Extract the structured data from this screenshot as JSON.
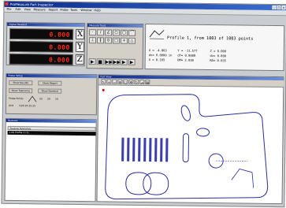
{
  "window": {
    "title": "ProMeasure Part Inspector",
    "minimize": "_",
    "maximize": "□",
    "close": "×"
  },
  "menu": [
    "File",
    "Edit",
    "View",
    "Measure",
    "Report",
    "Probe",
    "Tools",
    "Window",
    "Help"
  ],
  "dro": {
    "title": "Digital Readout",
    "x": {
      "axis": "X",
      "value": "0.000"
    },
    "y": {
      "axis": "Y",
      "value": "0.000"
    },
    "z": {
      "axis": "Z",
      "value": "0.000"
    }
  },
  "tools": {
    "title": "Measure Tools",
    "buttons": [
      "·",
      "/",
      "∠",
      "○",
      "◯",
      "⌒",
      "⊥",
      "∥",
      "⊙",
      "□",
      "+",
      "△"
    ],
    "play_buttons": [
      "▶",
      "■",
      "▶▶",
      "▶▶",
      "▶",
      "▶"
    ]
  },
  "info": {
    "header": "Profile 1, from 1003 of 1003 points",
    "lines": [
      "X = -4.803      Y = -11.577       Z = 0.000",
      "dx= 0.0000 in   dY= 0.0000        dz= 0.000",
      "X = 0.105       DM= 2.038         RD= 0.035"
    ]
  },
  "probe": {
    "title": "Probe Setup",
    "buttons": [
      "Show Results",
      "Show Report",
      "Show Tolerance",
      "Show Nominal"
    ],
    "probe_label": "Probe Points",
    "values": [
      "25",
      "20",
      "10"
    ],
    "unit_label": "Unit",
    "units": "1/20   25   25   25"
  },
  "list": {
    "title": "Features",
    "column": "Feature   Tolerance",
    "selected": "1.00 Profile 1   (1)"
  },
  "drawing": {
    "title": "Part View"
  },
  "colors": {
    "part_outline": "#2b2f9e",
    "dro_digits": "#ff2a1a",
    "titlebar": "#0b2a8a"
  }
}
